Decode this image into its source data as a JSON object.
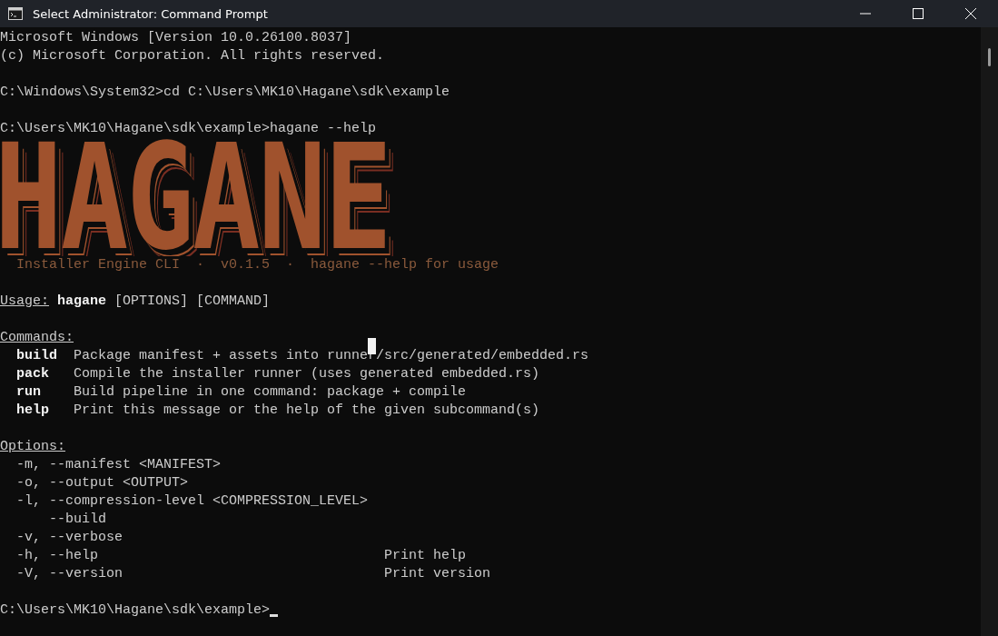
{
  "window": {
    "title": "Select Administrator: Command Prompt"
  },
  "header_lines": [
    "Microsoft Windows [Version 10.0.26100.8037]",
    "(c) Microsoft Corporation. All rights reserved."
  ],
  "prompts": [
    {
      "path": "C:\\Windows\\System32>",
      "command": "cd C:\\Users\\MK10\\Hagane\\sdk\\example"
    },
    {
      "path": "C:\\Users\\MK10\\Hagane\\sdk\\example>",
      "command": "hagane --help"
    }
  ],
  "logo": "HAGANE",
  "tagline": "Installer Engine CLI  ·  v0.1.5  ·  hagane --help for usage",
  "usage": {
    "label": "Usage:",
    "program": "hagane",
    "args": "[OPTIONS] [COMMAND]"
  },
  "commands": {
    "heading": "Commands:",
    "items": [
      {
        "name": "build",
        "description": "Package manifest + assets into runner/src/generated/embedded.rs"
      },
      {
        "name": "pack",
        "description": "Compile the installer runner (uses generated embedded.rs)"
      },
      {
        "name": "run",
        "description": "Build pipeline in one command: package + compile"
      },
      {
        "name": "help",
        "description": "Print this message or the help of the given subcommand(s)"
      }
    ]
  },
  "options": {
    "heading": "Options:",
    "items": [
      {
        "kind": "short",
        "flags": "-m, --manifest <MANIFEST>"
      },
      {
        "kind": "short",
        "flags": "-o, --output <OUTPUT>"
      },
      {
        "kind": "short",
        "flags": "-l, --compression-level <COMPRESSION_LEVEL>"
      },
      {
        "kind": "long",
        "flags": "--build"
      },
      {
        "kind": "short",
        "flags": "-v, --verbose"
      },
      {
        "kind": "short",
        "flags": "-h, --help",
        "description": "Print help"
      },
      {
        "kind": "short",
        "flags": "-V, --version",
        "description": "Print version"
      }
    ]
  },
  "final_prompt": "C:\\Users\\MK10\\Hagane\\sdk\\example>"
}
